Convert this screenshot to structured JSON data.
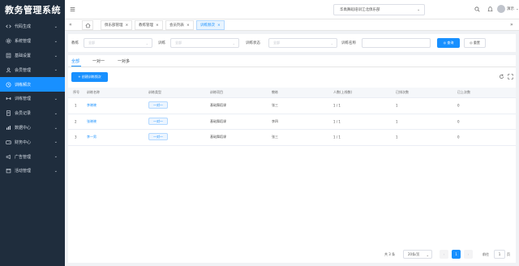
{
  "app": {
    "title": "教务管理系统"
  },
  "sidebar": {
    "items": [
      {
        "label": "代码生成",
        "icon": "code-icon",
        "active": false,
        "arrow": "⌄"
      },
      {
        "label": "系统管理",
        "icon": "gear-icon",
        "active": false,
        "arrow": "⌄"
      },
      {
        "label": "基础设置",
        "icon": "settings-icon",
        "active": false,
        "arrow": "⌄"
      },
      {
        "label": "会员管理",
        "icon": "user-icon",
        "active": false,
        "arrow": "⌄"
      },
      {
        "label": "训练频次",
        "icon": "clock-icon",
        "active": true,
        "arrow": ""
      },
      {
        "label": "训练管理",
        "icon": "dumbbell-icon",
        "active": false,
        "arrow": "⌄"
      },
      {
        "label": "会员记录",
        "icon": "record-icon",
        "active": false,
        "arrow": "⌄"
      },
      {
        "label": "数据中心",
        "icon": "chart-icon",
        "active": false,
        "arrow": "⌄"
      },
      {
        "label": "财务中心",
        "icon": "wallet-icon",
        "active": false,
        "arrow": "⌄"
      },
      {
        "label": "广告管理",
        "icon": "ad-icon",
        "active": false,
        "arrow": "⌄"
      },
      {
        "label": "活动管理",
        "icon": "calendar-icon",
        "active": false,
        "arrow": "⌄"
      }
    ]
  },
  "topbar": {
    "hamburger_icon": "menu-icon",
    "school": "华禹舞蹈培训江北俱乐部",
    "user_name": "演示",
    "caret": "⌄"
  },
  "tabs": {
    "prev": "«",
    "next": "»",
    "items": [
      {
        "label": "俱乐部管理",
        "close": "×",
        "active": false
      },
      {
        "label": "教练管理",
        "close": "×",
        "active": false
      },
      {
        "label": "会员列表",
        "close": "×",
        "active": false
      },
      {
        "label": "训练频次",
        "close": "×",
        "active": true
      }
    ]
  },
  "filter": {
    "coach_label": "教练",
    "coach_placeholder": "全部",
    "training_label": "训练",
    "training_placeholder": "全部",
    "status_label": "训练状态",
    "status_placeholder": "全部",
    "name_label": "训练名称",
    "name_value": "",
    "search_btn": "◎ 查询",
    "reset_btn": "◎ 重置"
  },
  "subtabs": [
    "全部",
    "一对一",
    "一对多"
  ],
  "create_btn": "+ 创建训练频次",
  "table": {
    "headers": [
      "序号",
      "训练名称",
      "训练类型",
      "训练项目",
      "教练",
      "人数(上线数)",
      "已排次数",
      "已上次数"
    ],
    "rows": [
      {
        "no": "1",
        "name": "李晓晓",
        "type": "一对一",
        "project": "基础舞蹈课",
        "coach": "张三",
        "count": "1 / 1",
        "scheduled": "1",
        "attended": "0"
      },
      {
        "no": "2",
        "name": "张晓晓",
        "type": "一对一",
        "project": "基础舞蹈课",
        "coach": "李四",
        "count": "1 / 1",
        "scheduled": "1",
        "attended": "0"
      },
      {
        "no": "3",
        "name": "李一男",
        "type": "一对一",
        "project": "基础舞蹈课",
        "coach": "张三",
        "count": "1 / 1",
        "scheduled": "1",
        "attended": "0"
      }
    ]
  },
  "pager": {
    "total": "共 3 条",
    "page_size": "20条/页",
    "prev": "‹",
    "current": "1",
    "next": "›",
    "goto": "前往",
    "jump_value": "1",
    "page_suffix": "页"
  },
  "colors": {
    "accent": "#1890ff",
    "sidebar_bg": "#1f2d3d"
  }
}
